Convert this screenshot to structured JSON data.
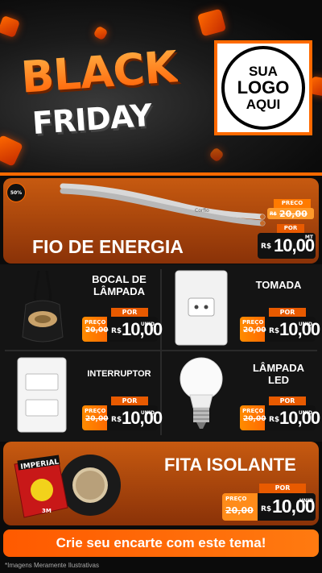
{
  "hero": {
    "headline_top": "BLACK",
    "headline_bottom": "FRIDAY",
    "logo_line1": "SUA",
    "logo_line2": "LOGO",
    "logo_line3": "AQUI"
  },
  "badge": "50%",
  "featured": {
    "name": "FIO DE ENERGIA",
    "cable_print": "Corfio",
    "preco_label": "PRECO",
    "old_price": "20,00",
    "old_currency": "R$",
    "por_label": "POR",
    "currency": "R$",
    "price": "10,00",
    "unit": "MT"
  },
  "items": [
    {
      "name_line1": "BOCAL DE",
      "name_line2": "LÂMPADA",
      "preco_label": "PREÇO",
      "old_price": "20,00",
      "currency": "R$",
      "price": "10,00",
      "unit": "UNID",
      "por_label": "POR"
    },
    {
      "name_line1": "TOMADA",
      "name_line2": "",
      "preco_label": "PREÇO",
      "old_price": "20,00",
      "currency": "R$",
      "price": "10,00",
      "unit": "UNID",
      "por_label": "POR"
    },
    {
      "name_line1": "INTERRUPTOR",
      "name_line2": "",
      "preco_label": "PREÇO",
      "old_price": "20,00",
      "currency": "R$",
      "price": "10,00",
      "unit": "UNID",
      "por_label": "POR"
    },
    {
      "name_line1": "LÂMPADA",
      "name_line2": "LED",
      "preco_label": "PREÇO",
      "old_price": "20,00",
      "currency": "R$",
      "price": "10,00",
      "unit": "UNID",
      "por_label": "POR"
    }
  ],
  "tape": {
    "name": "FITA ISOLANTE",
    "brand": "IMPERIAL",
    "maker": "3M",
    "preco_label": "PREÇO",
    "old_price": "20,00",
    "currency": "R$",
    "price": "10,00",
    "unit": "UNID",
    "por_label": "POR"
  },
  "cta": "Crie seu encarte com este tema!",
  "footnote": "*Imagens Meramente Ilustrativas",
  "colors": {
    "accent": "#ff6a00",
    "dark": "#141414",
    "band": "#b84d0c"
  }
}
